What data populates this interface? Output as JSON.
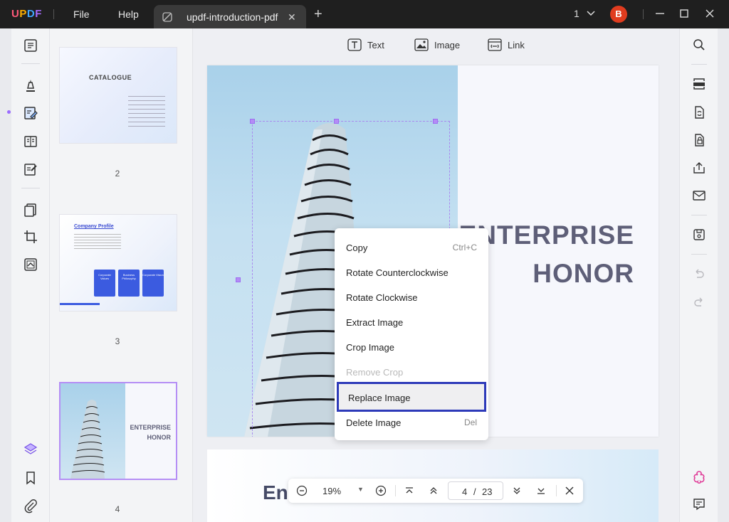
{
  "app": {
    "logo": [
      "U",
      "P",
      "D",
      "F"
    ]
  },
  "menu": {
    "file": "File",
    "help": "Help"
  },
  "tab": {
    "title": "updf-introduction-pdf",
    "close": "✕",
    "new_tab": "+"
  },
  "header": {
    "page_selector": "1",
    "avatar_initial": "B",
    "avatar_color": "#e03c1f"
  },
  "edit_toolbar": {
    "text": "Text",
    "image": "Image",
    "link": "Link"
  },
  "thumbnails": [
    {
      "number": "2",
      "title": "CATALOGUE"
    },
    {
      "number": "3",
      "title": "Company Profile",
      "cards": [
        "Corporate Values",
        "Business Philosophy",
        "Corporate Vision"
      ]
    },
    {
      "number": "4",
      "title_line1": "ENTERPRISE",
      "title_line2": "HONOR"
    }
  ],
  "page": {
    "heading_line1": "ENTERPRISE",
    "heading_line2": "HONOR",
    "next_page_text": "Ent"
  },
  "context_menu": {
    "items": [
      {
        "label": "Copy",
        "shortcut": "Ctrl+C"
      },
      {
        "label": "Rotate Counterclockwise",
        "shortcut": ""
      },
      {
        "label": "Rotate Clockwise",
        "shortcut": ""
      },
      {
        "label": "Extract Image",
        "shortcut": ""
      },
      {
        "label": "Crop Image",
        "shortcut": ""
      },
      {
        "label": "Remove Crop",
        "shortcut": "",
        "disabled": true
      },
      {
        "label": "Replace Image",
        "shortcut": "",
        "highlighted": true
      },
      {
        "label": "Delete Image",
        "shortcut": "Del"
      }
    ]
  },
  "zoom_bar": {
    "zoom": "19%",
    "current_page": "4",
    "separator": "/",
    "total_pages": "23"
  },
  "colors": {
    "accent": "#9b6bff",
    "highlight_border": "#2d3ab9",
    "titlebar": "#1f1f1f"
  }
}
